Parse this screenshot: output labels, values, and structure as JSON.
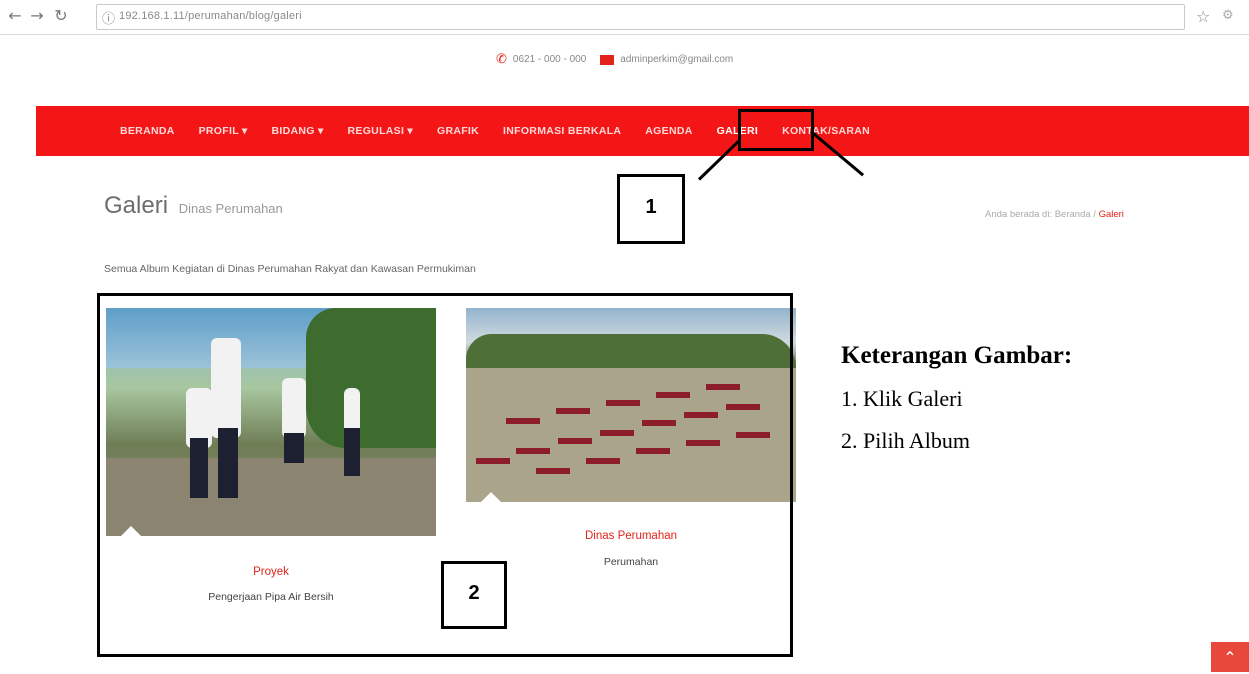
{
  "browser": {
    "url": "192.168.1.11/perumahan/blog/galeri"
  },
  "contact": {
    "phone": "0621 - 000 - 000",
    "email": "adminperkim@gmail.com"
  },
  "nav": {
    "items": [
      "BERANDA",
      "PROFIL",
      "BIDANG",
      "REGULASI",
      "GRAFIK",
      "INFORMASI BERKALA",
      "AGENDA",
      "GALERI",
      "KONTAK/SARAN"
    ]
  },
  "page": {
    "title": "Galeri",
    "subtitle": "Dinas Perumahan",
    "breadcrumb_prefix": "Anda berada di: Beranda /",
    "breadcrumb_current": "Galeri",
    "lead": "Semua Album Kegiatan di Dinas Perumahan Rakyat dan Kawasan Permukiman"
  },
  "albums": [
    {
      "title": "Proyek",
      "subtitle": "Pengerjaan Pipa Air Bersih"
    },
    {
      "title": "Dinas Perumahan",
      "subtitle": "Perumahan"
    }
  ],
  "annotations": {
    "box1": "1",
    "box2": "2"
  },
  "notes": {
    "heading": "Keterangan Gambar:",
    "item1": "1. Klik Galeri",
    "item2": "2. Pilih Album"
  },
  "colors": {
    "accent": "#f41616",
    "text_red": "#e2231a"
  }
}
